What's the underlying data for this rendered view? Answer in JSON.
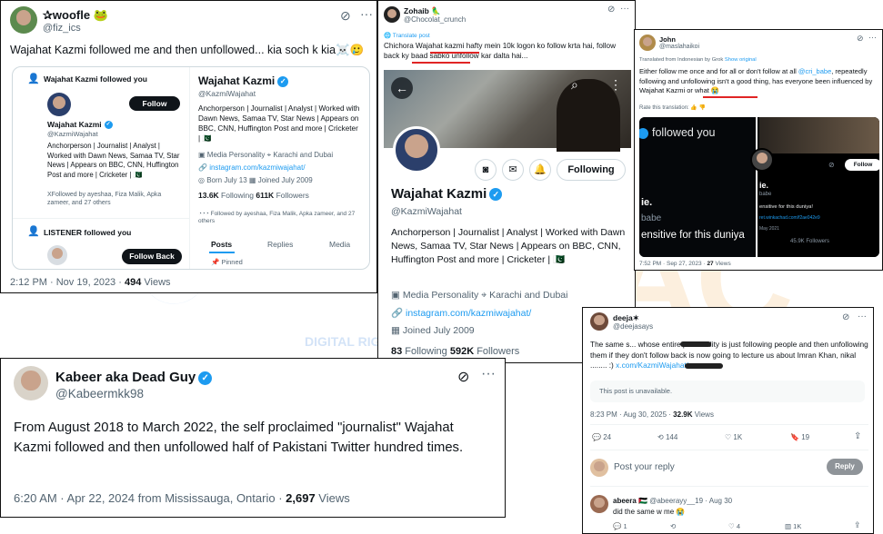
{
  "p1": {
    "name": "✰woofle",
    "emoji": "🐸",
    "handle": "@fiz_ics",
    "text": "Wajahat Kazmi followed me and then unfollowed... kia soch k kia☠️🥲",
    "time": "2:12 PM · Nov 19, 2023 · ",
    "views": "494",
    "views_label": " Views",
    "followed_you": "Wajahat Kazmi followed you",
    "follow_label": "Follow",
    "mini_name": "Wajahat Kazmi",
    "mini_handle": "@KazmiWajahat",
    "mini_bio": "Anchorperson | Journalist | Analyst | Worked with Dawn News, Samaa TV, Star News | Appears on BBC, CNN, Huffington Post and more | Cricketer | 🇵🇰",
    "mini_followed_by": "XFollowed by ayeshaa, Fiza Malik, Apka zameer, and 27 others",
    "listener_followed": "LISTENER followed you",
    "follow_back_label": "Follow Back",
    "big_name": "Wajahat Kazmi",
    "big_handle": "@KazmiWajahat",
    "big_bio": "Anchorperson | Journalist | Analyst | Worked with Dawn News, Samaa TV, Star News | Appears on BBC, CNN, Huffington Post and more | Cricketer | 🇵🇰",
    "category": "Media Personality",
    "location": "Karachi and Dubai",
    "link": "instagram.com/kazmiwajahat/",
    "born": "Born July 13",
    "joined": "Joined July 2009",
    "following": "13.6K",
    "following_label": " Following",
    "followers": "611K",
    "followers_label": " Followers",
    "followed_by2": "Followed by ayeshaa, Fiza Malik, Apka zameer, and 27 others",
    "tabs": [
      "Posts",
      "Replies",
      "Media"
    ],
    "pinned": "Pinned"
  },
  "p2": {
    "name": "Zohaib",
    "emoji": "🦜",
    "handle": "@Chocolat_crunch",
    "translate": "Translate post",
    "text": "Chichora Wajahat kazmi hafty mein 10k logon ko follow krta hai, follow back ky baad sabko unfollow kar dalta hai...",
    "profile_name": "Wajahat Kazmi",
    "profile_handle": "@KazmiWajahat",
    "following_btn": "Following",
    "bio": "Anchorperson | Journalist | Analyst | Worked with Dawn News, Samaa TV, Star News | Appears on BBC, CNN, Huffington Post and more | Cricketer | 🇵🇰",
    "category": "Media Personality",
    "location": "Karachi and Dubai",
    "link": "instagram.com/kazmiwajahat/",
    "joined": "Joined July 2009",
    "following": "83",
    "following_label": " Following",
    "followers": "592K",
    "followers_label": " Followers"
  },
  "p3": {
    "name": "John",
    "handle": "@maslahaikoi",
    "translated": "Translated from Indonesian by Grok",
    "show_original": "Show original",
    "text_a": "Either follow me once and for all or don't follow at all ",
    "mention": "@cri_babe",
    "text_b": ", repeatedly following and unfollowing isn't a good thing, has everyone been influenced by Wajahat Kazmi or what 😭",
    "rate": "Rate this translation:",
    "img_text1": "followed you",
    "img_text2": "ie.",
    "img_text3": "babe",
    "img_text4": "ensitive for this duniya",
    "img_text5": "ensitive for this duniya!",
    "img_text6": "ret.winkachad.com/f2ae042e9",
    "img_text7": "May 2021",
    "img_text8": "45.9K Followers",
    "img_follow": "Follow",
    "time": "7:52 PM · Sep 27, 2023 · ",
    "views": "27",
    "views_label": " Views"
  },
  "p4": {
    "name": "Kabeer aka Dead Guy",
    "handle": "@Kabeermkk98",
    "text": "From August 2018 to March 2022, the self proclaimed \"journalist\" Wajahat Kazmi followed and then unfollowed half of Pakistani Twitter hundred times.",
    "time": "6:20 AM · Apr 22, 2024 from Mississauga, Ontario · ",
    "views": "2,697",
    "views_label": " Views"
  },
  "p5": {
    "name": "deeja✶",
    "handle": "@deejasays",
    "text": "The same s... whose entire personality is just following people and then unfollowing them if they don't follow back is now going to lecture us about Imran Khan, nikal ........ :) ",
    "link": "x.com/KazmiWajahat/s...",
    "unavailable": "This post is unavailable.",
    "time": "8:23 PM · Aug 30, 2025 · ",
    "views": "32.9K",
    "views_label": " Views",
    "replies": "24",
    "reposts": "144",
    "likes": "1K",
    "bookmarks": "19",
    "reply_placeholder": "Post your reply",
    "reply_btn": "Reply",
    "r_name": "abeera",
    "r_flag": "🇵🇸",
    "r_handle": "@abeerayy__19 · Aug 30",
    "r_text": "did the same w me 😭",
    "r_replies": "1",
    "r_likes": "4",
    "r_views": "1K"
  },
  "watermark": {
    "text1": "DIGITAL RIGHTS RESEARCH AND ANALYSIS CENTER"
  }
}
